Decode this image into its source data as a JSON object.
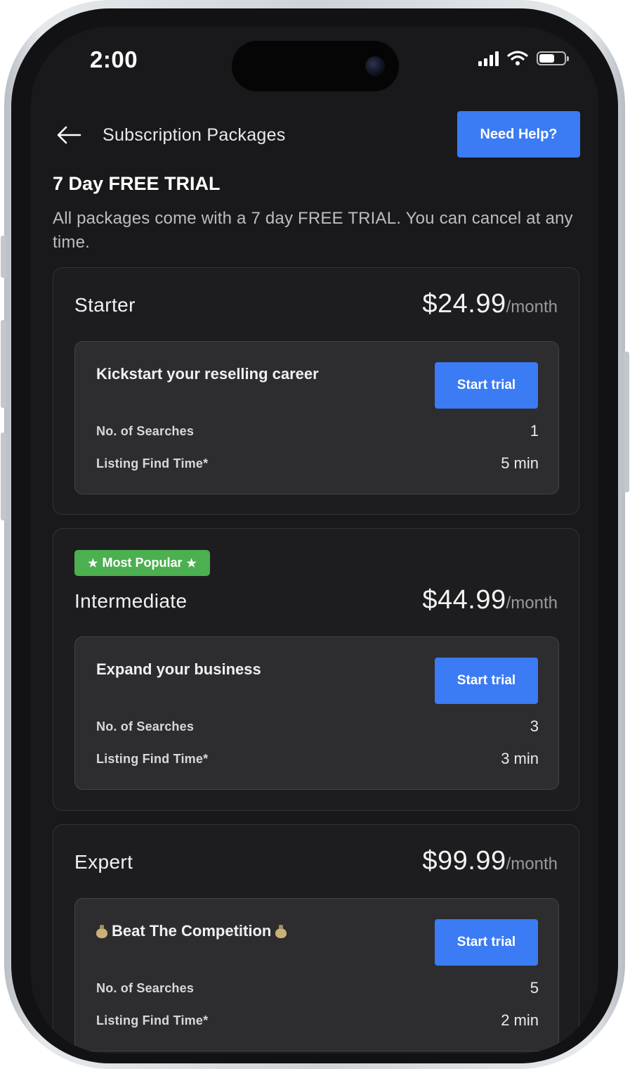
{
  "status_bar": {
    "time": "2:00"
  },
  "header": {
    "title": "Subscription Packages",
    "help_label": "Need Help?"
  },
  "trial": {
    "heading": "7 Day FREE TRIAL",
    "description": "All packages come with a 7 day FREE TRIAL. You can cancel at any time."
  },
  "plans": [
    {
      "name": "Starter",
      "price": "$24.99",
      "period": "/month",
      "tagline": "Kickstart your reselling career",
      "button_label": "Start trial",
      "rows": [
        {
          "label": "No. of Searches",
          "value": "1"
        },
        {
          "label": "Listing Find Time*",
          "value": "5 min"
        }
      ]
    },
    {
      "badge": "Most Popular",
      "name": "Intermediate",
      "price": "$44.99",
      "period": "/month",
      "tagline": "Expand your business",
      "button_label": "Start trial",
      "rows": [
        {
          "label": "No. of Searches",
          "value": "3"
        },
        {
          "label": "Listing Find Time*",
          "value": "3 min"
        }
      ]
    },
    {
      "name": "Expert",
      "price": "$99.99",
      "period": "/month",
      "tagline": "Beat The Competition",
      "button_label": "Start trial",
      "rows": [
        {
          "label": "No. of Searches",
          "value": "5"
        },
        {
          "label": "Listing Find Time*",
          "value": "2 min"
        }
      ]
    }
  ],
  "colors": {
    "accent": "#3b7bf3",
    "badge": "#4caf50",
    "background": "#19191b",
    "card": "#1d1d1f",
    "inner_card": "#2d2d30"
  },
  "icons": [
    "back-arrow-icon",
    "cellular-signal-icon",
    "wifi-icon",
    "battery-icon",
    "star-icon",
    "money-bag-icon"
  ]
}
